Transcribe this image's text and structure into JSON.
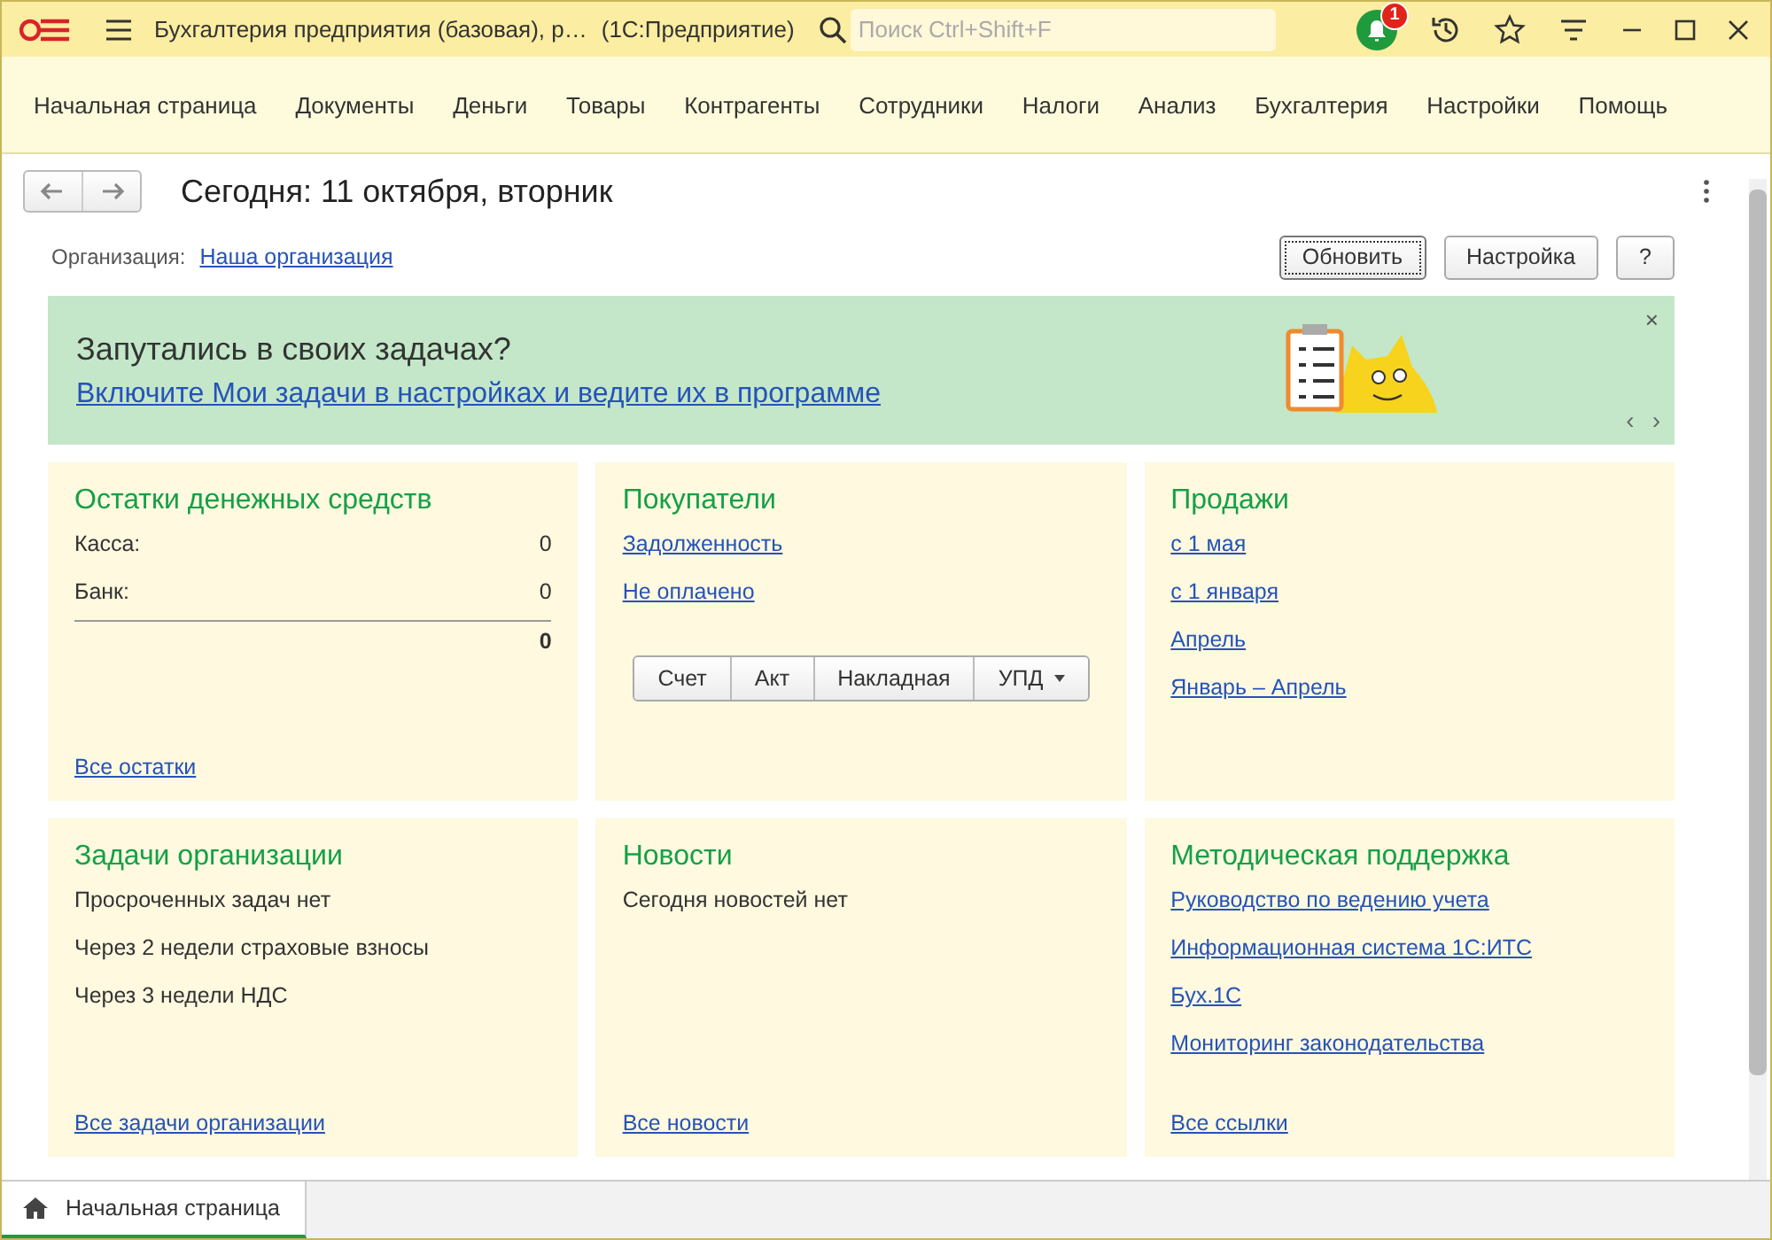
{
  "title_bar": {
    "title": "Бухгалтерия предприятия (базовая), р…",
    "app_name": "(1С:Предприятие)",
    "search": {
      "placeholder": "Поиск Ctrl+Shift+F"
    },
    "notification_count": "1"
  },
  "menu": [
    {
      "label": "Начальная страница"
    },
    {
      "label": "Документы"
    },
    {
      "label": "Деньги"
    },
    {
      "label": "Товары"
    },
    {
      "label": "Контрагенты"
    },
    {
      "label": "Сотрудники"
    },
    {
      "label": "Налоги"
    },
    {
      "label": "Анализ"
    },
    {
      "label": "Бухгалтерия"
    },
    {
      "label": "Настройки"
    },
    {
      "label": "Помощь"
    }
  ],
  "page": {
    "title": "Сегодня: 11 октября, вторник",
    "organization_label": "Организация:",
    "organization_link": "Наша организация",
    "buttons": [
      {
        "label": "Обновить",
        "selected": true
      },
      {
        "label": "Настройка",
        "selected": false
      },
      {
        "label": "?",
        "selected": false
      }
    ]
  },
  "banner": {
    "heading": "Запутались в своих задачах?",
    "link": "Включите Мои задачи в настройках и ведите их в программе",
    "close": "×",
    "prev": "‹",
    "next": "›"
  },
  "panels": [
    {
      "title": "Остатки денежных средств",
      "items": [
        {
          "kind": "pair",
          "label": "Касса:",
          "value": "0"
        },
        {
          "kind": "pair",
          "label": "Банк:",
          "value": "0"
        },
        {
          "kind": "total",
          "value": "0"
        }
      ],
      "footer_link": "Все остатки"
    },
    {
      "title": "Покупатели",
      "items": [
        {
          "kind": "link",
          "text": "Задолженность"
        },
        {
          "kind": "link",
          "text": "Не оплачено"
        },
        {
          "kind": "buttons",
          "buttons": [
            {
              "label": "Счет",
              "dropdown": false
            },
            {
              "label": "Акт",
              "dropdown": false
            },
            {
              "label": "Накладная",
              "dropdown": false
            },
            {
              "label": "УПД",
              "dropdown": true
            }
          ]
        }
      ]
    },
    {
      "title": "Продажи",
      "items": [
        {
          "kind": "link",
          "text": "с 1 мая"
        },
        {
          "kind": "link",
          "text": "с 1 января"
        },
        {
          "kind": "link",
          "text": "Апрель"
        },
        {
          "kind": "link",
          "text": "Январь – Апрель"
        }
      ]
    },
    {
      "title": "Задачи организации",
      "items": [
        {
          "kind": "text",
          "text": "Просроченных задач нет"
        },
        {
          "kind": "text",
          "text": "Через 2 недели страховые взносы"
        },
        {
          "kind": "text",
          "text": "Через 3 недели НДС"
        }
      ],
      "footer_link": "Все задачи организации"
    },
    {
      "title": "Новости",
      "items": [
        {
          "kind": "text",
          "text": "Сегодня новостей нет"
        }
      ],
      "footer_link": "Все новости"
    },
    {
      "title": "Методическая поддержка",
      "items": [
        {
          "kind": "link",
          "text": "Руководство по ведению учета"
        },
        {
          "kind": "link",
          "text": "Информационная система 1С:ИТС"
        },
        {
          "kind": "link",
          "text": "Бух.1С"
        },
        {
          "kind": "link",
          "text": "Мониторинг законодательства"
        }
      ],
      "footer_link": "Все ссылки"
    }
  ],
  "open_tabs": [
    {
      "label": "Начальная страница",
      "selected": true
    }
  ]
}
